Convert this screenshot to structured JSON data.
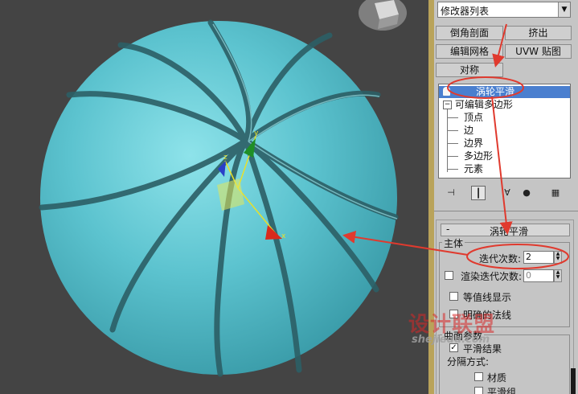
{
  "modifier_list": {
    "label": "修改器列表"
  },
  "buttons": {
    "chamfer": "倒角剖面",
    "extrude": "挤出",
    "edit_mesh": "编辑网格",
    "uvw_map": "UVW 贴图",
    "symmetry": "对称"
  },
  "stack": {
    "items": [
      {
        "label": "涡轮平滑",
        "selected": true
      },
      {
        "label": "可编辑多边形",
        "selected": false
      },
      {
        "label": "顶点"
      },
      {
        "label": "边"
      },
      {
        "label": "边界"
      },
      {
        "label": "多边形"
      },
      {
        "label": "元素"
      }
    ]
  },
  "rollout": {
    "collapse": "-",
    "title": "涡轮平滑",
    "main_group": "主体",
    "iterations_label": "迭代次数:",
    "iterations_value": "2",
    "render_iters_label": "渲染迭代次数:",
    "render_iters_value": "0",
    "isoline": "等值线显示",
    "explicit_normals": "明确的法线",
    "surface_group": "曲面参数",
    "smooth_result": "平滑结果",
    "separate_by": "分隔方式:",
    "materials": "材质",
    "smoothing_groups": "平滑组"
  },
  "viewport": {
    "ball_color": "#4db8c6",
    "axis_x": "x",
    "axis_y": "y",
    "axis_z": "z"
  },
  "watermark": {
    "main": "设计联盟",
    "sub": "shejiedu.com"
  },
  "colors": {
    "annotation": "#e03a2e",
    "panel_bg": "#c5c5c5",
    "selected": "#4a7fcf"
  }
}
